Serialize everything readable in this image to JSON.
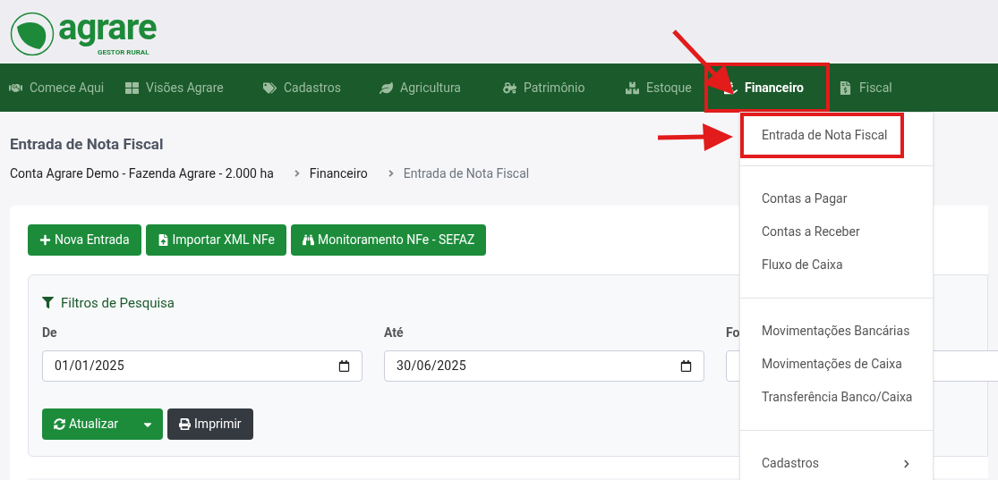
{
  "logo": {
    "name": "agrare",
    "tagline": "GESTOR RURAL"
  },
  "nav": [
    {
      "label": "Comece Aqui",
      "selected": false,
      "highlighted": false
    },
    {
      "label": "Visões Agrare",
      "selected": false,
      "highlighted": false
    },
    {
      "label": "Cadastros",
      "selected": false,
      "highlighted": false
    },
    {
      "label": "Agricultura",
      "selected": false,
      "highlighted": false
    },
    {
      "label": "Patrimônio",
      "selected": false,
      "highlighted": false
    },
    {
      "label": "Estoque",
      "selected": false,
      "highlighted": false
    },
    {
      "label": "Financeiro",
      "selected": true,
      "highlighted": true
    },
    {
      "label": "Fiscal",
      "selected": false,
      "highlighted": false
    }
  ],
  "dropdown": {
    "groups": [
      [
        {
          "label": "Entrada de Nota Fiscal",
          "kind": "link",
          "highlighted": true
        }
      ],
      [
        {
          "label": "Contas a Pagar",
          "kind": "link",
          "highlighted": false
        },
        {
          "label": "Contas a Receber",
          "kind": "link",
          "highlighted": false
        },
        {
          "label": "Fluxo de Caixa",
          "kind": "link",
          "highlighted": false
        }
      ],
      [
        {
          "label": "Movimentações Bancárias",
          "kind": "link",
          "highlighted": false
        },
        {
          "label": "Movimentações de Caixa",
          "kind": "link",
          "highlighted": false
        },
        {
          "label": "Transferência Banco/Caixa",
          "kind": "link",
          "highlighted": false
        }
      ],
      [
        {
          "label": "Cadastros",
          "kind": "submenu",
          "highlighted": false
        }
      ]
    ]
  },
  "annotations": [
    {
      "kind": "arrow"
    },
    {
      "kind": "arrow"
    }
  ],
  "page": {
    "title": "Entrada de Nota Fiscal",
    "breadcrumb": [
      {
        "label": "Conta Agrare Demo - Fazenda Agrare - 2.000 ha",
        "current": false
      },
      {
        "label": "Financeiro",
        "current": false
      },
      {
        "label": "Entrada de Nota Fiscal",
        "current": true
      }
    ]
  },
  "toolbar": [
    {
      "label": "Nova Entrada"
    },
    {
      "label": "Importar XML NFe"
    },
    {
      "label": "Monitoramento NFe - SEFAZ"
    }
  ],
  "filters": {
    "title": "Filtros de Pesquisa",
    "fields": [
      {
        "label": "De",
        "value": "01/01/2025",
        "kind": "date"
      },
      {
        "label": "Até",
        "value": "30/06/2025",
        "kind": "date"
      },
      {
        "label": "Fo",
        "kind": "select"
      }
    ],
    "actions": [
      {
        "label": "Atualizar",
        "kind": "split"
      },
      {
        "label": "Imprimir",
        "kind": "dark"
      }
    ]
  }
}
